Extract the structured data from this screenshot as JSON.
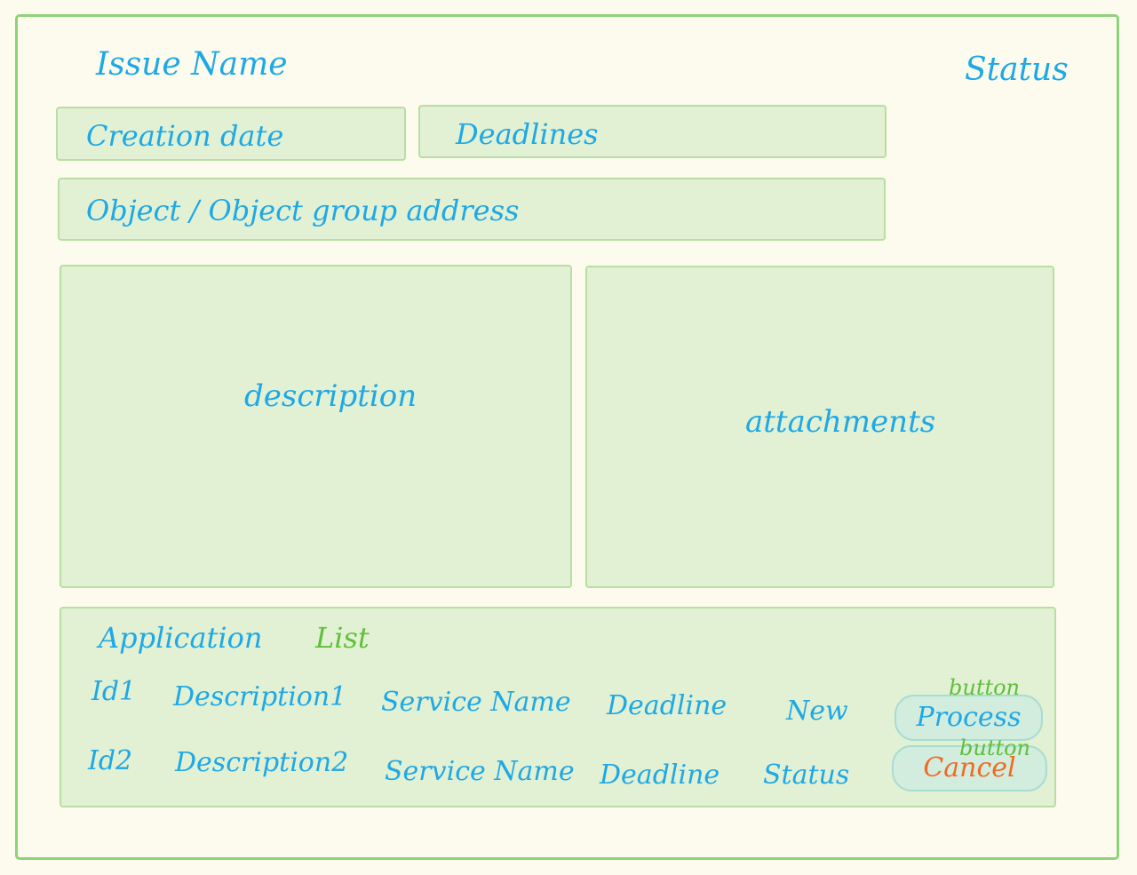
{
  "header": {
    "issue_name": "Issue Name",
    "status": "Status"
  },
  "fields": {
    "creation_date": "Creation date",
    "deadlines": "Deadlines",
    "object_address": "Object / Object group   address"
  },
  "panels": {
    "description": "description",
    "attachments": "attachments"
  },
  "application_list": {
    "title": "Application",
    "title_accent": "List",
    "rows": [
      {
        "id": "Id1",
        "description": "Description1",
        "service": "Service Name",
        "deadline": "Deadline",
        "status": "New",
        "action": "Process",
        "action_note": "button"
      },
      {
        "id": "Id2",
        "description": "Description2",
        "service": "Service Name",
        "deadline": "Deadline",
        "status": "Status",
        "action": "Cancel",
        "action_note": "button"
      }
    ]
  },
  "colors": {
    "ink": "#1ea8e6",
    "frame": "#8ed27a",
    "panel": "#e2f1d3",
    "note": "#5fbf3c",
    "cancel": "#f06a25"
  }
}
